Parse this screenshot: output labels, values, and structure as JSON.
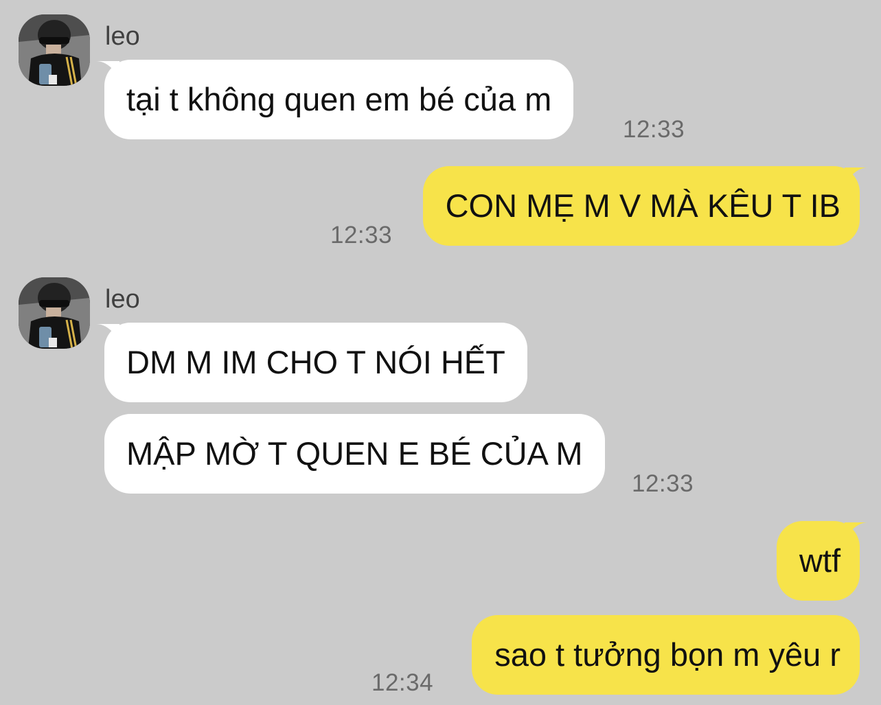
{
  "messages": [
    {
      "sender": "leo",
      "text": "tại t không quen em bé của m",
      "time": "12:33"
    },
    {
      "text": "CON MẸ M V MÀ KÊU T IB",
      "time": "12:33"
    },
    {
      "sender": "leo",
      "text": "DM M IM CHO T NÓI HẾT"
    },
    {
      "text": "MẬP MỜ T QUEN E BÉ CỦA M",
      "time": "12:33"
    },
    {
      "text": "wtf"
    },
    {
      "text": "sao t tưởng bọn m yêu r",
      "time": "12:34"
    }
  ],
  "colors": {
    "background": "#cbcbcb",
    "incoming_bubble": "#ffffff",
    "outgoing_bubble": "#f7e34a",
    "timestamp": "#6a6a6a"
  }
}
